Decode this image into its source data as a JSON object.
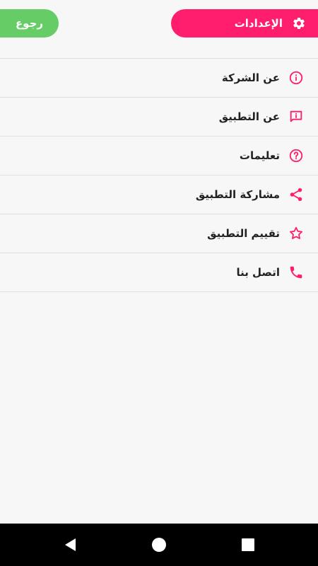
{
  "colors": {
    "accent": "#ff1e6e",
    "back_button": "#66cc66",
    "background": "#f7f7f7",
    "divider": "#e0e0e0",
    "nav_bar": "#000000"
  },
  "header": {
    "back_label": "رجوع",
    "title": "الإعدادات",
    "title_icon": "gear-icon"
  },
  "menu": {
    "items": [
      {
        "label": "عن الشركة",
        "icon": "info-circle-icon"
      },
      {
        "label": "عن التطبيق",
        "icon": "info-message-icon"
      },
      {
        "label": "تعليمات",
        "icon": "help-circle-icon"
      },
      {
        "label": "مشاركة التطبيق",
        "icon": "share-icon"
      },
      {
        "label": "تقييم التطبيق",
        "icon": "star-icon"
      },
      {
        "label": "اتصل بنا",
        "icon": "phone-icon"
      }
    ]
  },
  "nav": {
    "buttons": [
      "back-triangle-icon",
      "home-circle-icon",
      "recents-square-icon"
    ]
  }
}
